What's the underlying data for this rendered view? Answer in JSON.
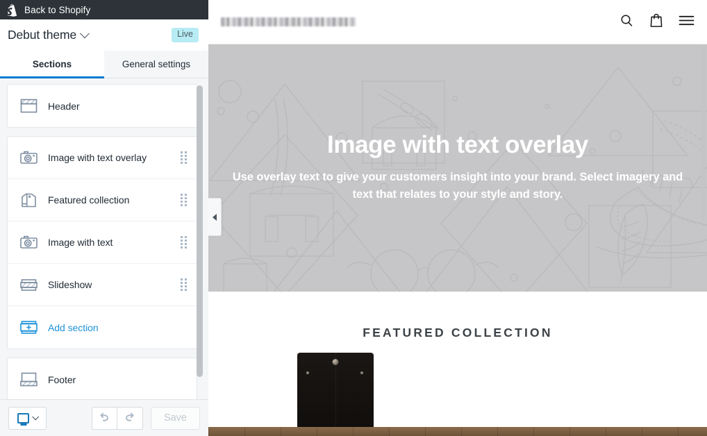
{
  "topbar": {
    "logo_icon": "shopify-bag-icon",
    "back_label": "Back to Shopify"
  },
  "theme_bar": {
    "theme_name": "Debut theme",
    "chevron_icon": "chevron-down-icon",
    "status_badge": "Live",
    "badge_color": "#b7ecf4"
  },
  "tabs": [
    {
      "label": "Sections",
      "active": true
    },
    {
      "label": "General settings",
      "active": false
    }
  ],
  "sections": {
    "groups": [
      {
        "items": [
          {
            "label": "Header",
            "icon": "header-layout-icon",
            "draggable": false
          }
        ]
      },
      {
        "items": [
          {
            "label": "Image with text overlay",
            "icon": "camera-icon",
            "draggable": true
          },
          {
            "label": "Featured collection",
            "icon": "shirt-icon",
            "draggable": true
          },
          {
            "label": "Image with text",
            "icon": "camera-icon",
            "draggable": true
          },
          {
            "label": "Slideshow",
            "icon": "slideshow-icon",
            "draggable": true
          },
          {
            "label": "Add section",
            "icon": "add-section-icon",
            "draggable": false,
            "link": true
          }
        ]
      },
      {
        "items": [
          {
            "label": "Footer",
            "icon": "footer-layout-icon",
            "draggable": false
          }
        ]
      }
    ]
  },
  "toolbar": {
    "device_icon": "monitor-icon",
    "device_chevron_icon": "chevron-down-icon",
    "undo_icon": "undo-arrow-icon",
    "redo_icon": "redo-arrow-icon",
    "save_label": "Save",
    "save_disabled": true
  },
  "collapse_handle": {
    "icon": "triangle-left-icon"
  },
  "preview": {
    "store_header": {
      "store_name": "",
      "store_name_redacted": true,
      "icons": [
        "search-icon",
        "shopping-bag-icon",
        "hamburger-menu-icon"
      ]
    },
    "hero": {
      "heading": "Image with text overlay",
      "paragraph": "Use overlay text to give your customers insight into your brand. Select imagery and text that relates to your style and story.",
      "background_color": "#c6c6c8",
      "placeholder_art": "shopify-product-lineart-placeholder"
    },
    "featured_collection": {
      "title": "FEATURED COLLECTION",
      "product_image": "black-jeans-product-photo"
    }
  }
}
